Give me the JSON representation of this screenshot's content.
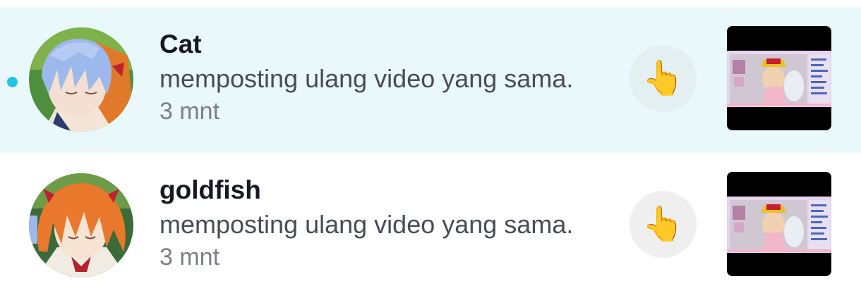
{
  "notifications": [
    {
      "username": "Cat",
      "action": "memposting ulang video yang sama.",
      "time": "3 mnt",
      "unread": true,
      "reaction_icon": "pointing-hand-emoji",
      "reaction_glyph": "👆"
    },
    {
      "username": "goldfish",
      "action": "memposting ulang video yang sama.",
      "time": "3 mnt",
      "unread": false,
      "reaction_icon": "pointing-hand-emoji",
      "reaction_glyph": "👆"
    }
  ],
  "colors": {
    "unread_background": "#e9f8fb",
    "unread_dot": "#22c3e6",
    "username": "#161823",
    "secondary_text": "#4a4c55"
  }
}
